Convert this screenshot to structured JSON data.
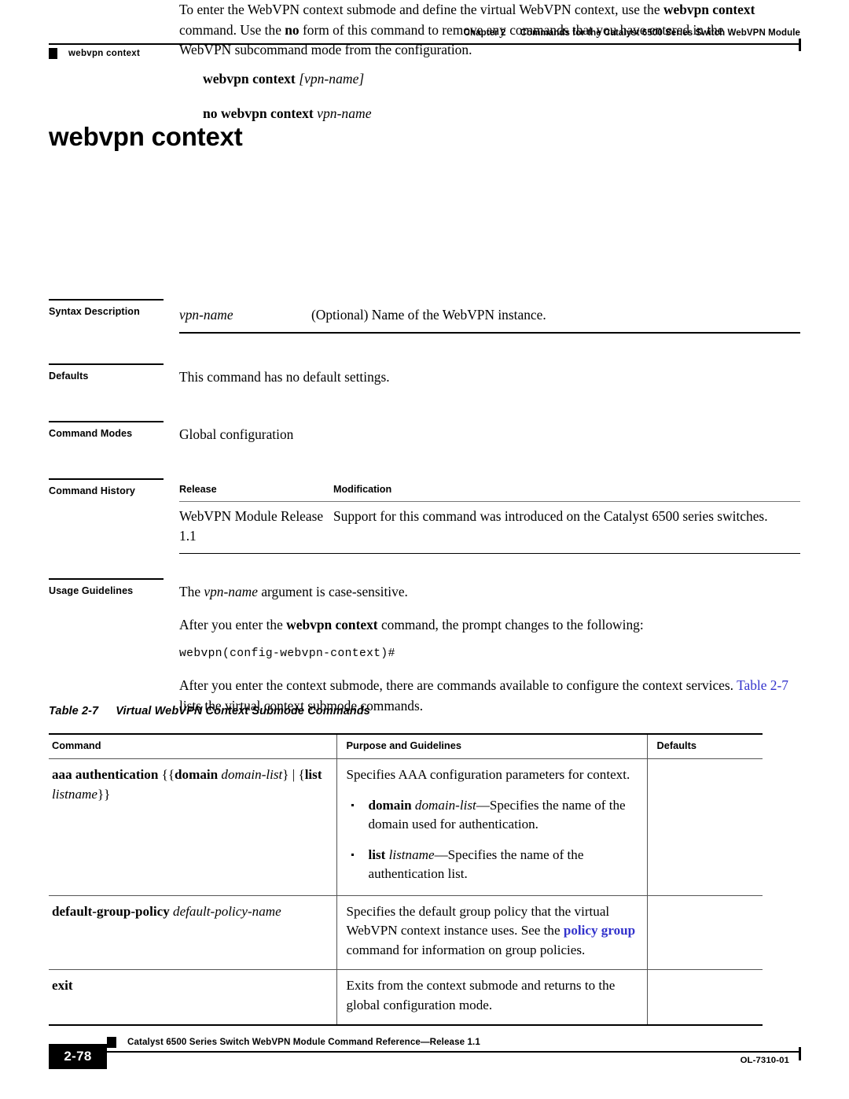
{
  "header": {
    "chapter_label": "Chapter 2",
    "chapter_title": "Commands for the Catalyst 6500 Series Switch WebVPN Module",
    "running_command": "webvpn context"
  },
  "title": "webvpn context",
  "intro": {
    "p1_part1": "To enter the WebVPN context submode and define the virtual WebVPN context, use the ",
    "p1_bold1": "webvpn context",
    "p1_part2": " command. Use the ",
    "p1_bold2": "no",
    "p1_part3": " form of this command to remove any commands that you have entered in the WebVPN subcommand mode from the configuration."
  },
  "syntax": {
    "line1_bold": "webvpn context",
    "line1_arg": "[vpn-name]",
    "line2_bold": "no webvpn context",
    "line2_arg": "vpn-name"
  },
  "sections": {
    "syntax_description": {
      "label": "Syntax Description",
      "arg": "vpn-name",
      "description": "(Optional) Name of the WebVPN instance."
    },
    "defaults": {
      "label": "Defaults",
      "text": "This command has no default settings."
    },
    "command_modes": {
      "label": "Command Modes",
      "text": "Global configuration"
    },
    "command_history": {
      "label": "Command History",
      "col_release": "Release",
      "col_modification": "Modification",
      "rows": [
        {
          "release": "WebVPN Module Release 1.1",
          "modification": "Support for this command was introduced on the Catalyst 6500 series switches."
        }
      ]
    },
    "usage_guidelines": {
      "label": "Usage Guidelines",
      "p1_part1": "The ",
      "p1_italic": "vpn-name",
      "p1_part2": " argument is case-sensitive.",
      "p2_part1": "After you enter the ",
      "p2_bold": "webvpn context",
      "p2_part2": " command, the prompt changes to the following:",
      "cli_prompt": "webvpn(config-webvpn-context)#",
      "p3_part1": "After you enter the context submode, there are commands available to configure the context services. ",
      "p3_link": "Table 2-7",
      "p3_part2": " lists the virtual context submode commands."
    }
  },
  "table_caption": {
    "number": "Table 2-7",
    "title": "Virtual WebVPN Context Submode Commands"
  },
  "command_table": {
    "columns": [
      "Command",
      "Purpose and Guidelines",
      "Defaults"
    ],
    "rows": [
      {
        "command_bold1": "aaa authentication",
        "command_rest1": " {{",
        "command_bold2": "domain",
        "command_italic2": "domain-list",
        "command_rest2": "} | {",
        "command_bold3": "list",
        "command_italic3": "listname",
        "command_rest3": "}}",
        "purpose_intro": "Specifies AAA configuration parameters for context.",
        "bullets": [
          {
            "bold": "domain",
            "italic": "domain-list",
            "text": "—Specifies the name of the domain used for authentication."
          },
          {
            "bold": "list",
            "italic": "listname",
            "text": "—Specifies the name of the authentication list."
          }
        ],
        "defaults": ""
      },
      {
        "command_bold1": "default-group-policy",
        "command_italic1": "default-policy-name",
        "purpose_part1": "Specifies the default group policy that the virtual WebVPN context instance uses. See the ",
        "purpose_link": "policy group",
        "purpose_part2": " command for information on group policies.",
        "defaults": ""
      },
      {
        "command_bold1": "exit",
        "purpose_part1": "Exits from the context submode and returns to the global configuration mode.",
        "defaults": ""
      }
    ]
  },
  "footer": {
    "doc_title": "Catalyst 6500 Series Switch WebVPN Module Command Reference—Release 1.1",
    "page_number": "2-78",
    "doc_id": "OL-7310-01"
  }
}
